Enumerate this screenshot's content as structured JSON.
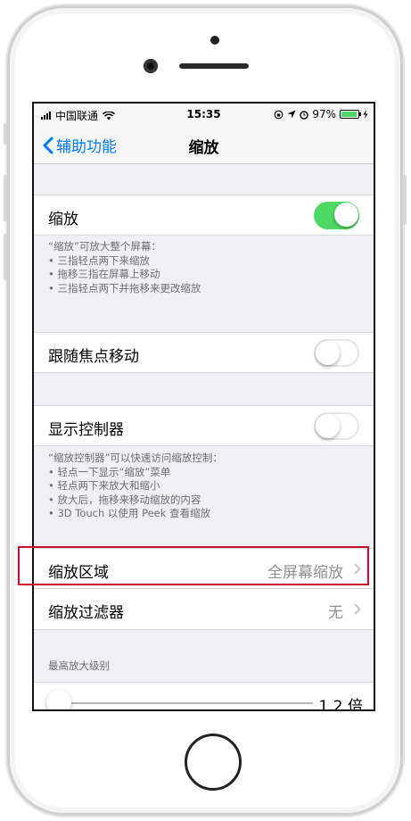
{
  "status_bar": {
    "carrier": "中国联通",
    "time": "15:35",
    "battery": "97%",
    "battery_fraction": 0.97
  },
  "nav": {
    "back_label": "辅助功能",
    "title": "缩放"
  },
  "zoom": {
    "label": "缩放",
    "enabled": true,
    "footer": [
      "“缩放”可放大整个屏幕：",
      "•  三指轻点两下来缩放",
      "•  拖移三指在屏幕上移动",
      "•  三指轻点两下并拖移来更改缩放"
    ]
  },
  "follow_focus": {
    "label": "跟随焦点移动",
    "enabled": false
  },
  "show_controller": {
    "label": "显示控制器",
    "enabled": false,
    "footer": [
      "“缩放控制器”可以快速访问缩放控制：",
      "• 轻点一下显示“缩放”菜单",
      "• 轻点两下来放大和缩小",
      "• 放大后，拖移来移动缩放的内容",
      "• 3D Touch 以使用 Peek 查看缩放"
    ]
  },
  "zoom_region": {
    "label": "缩放区域",
    "value": "全屏幕缩放"
  },
  "zoom_filter": {
    "label": "缩放过滤器",
    "value": "无"
  },
  "max_zoom": {
    "header": "最高放大级别",
    "value": "1.2 倍",
    "slider_fraction": 0.0
  },
  "colors": {
    "accent": "#007aff",
    "switch_on": "#4cd964",
    "highlight": "#c8102e"
  }
}
